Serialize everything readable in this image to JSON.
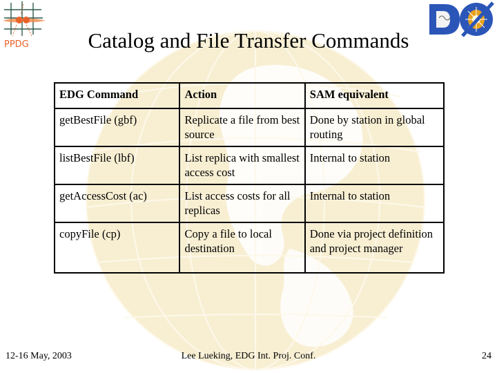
{
  "slide": {
    "title": "Catalog and File Transfer Commands",
    "logos": {
      "left": "PPDG",
      "right": "DØ"
    }
  },
  "table": {
    "headers": [
      "EDG Command",
      "Action",
      "SAM equivalent"
    ],
    "rows": [
      [
        "getBestFile (gbf)",
        "Replicate a file from best source",
        "Done by station in global routing"
      ],
      [
        "listBestFile (lbf)",
        "List replica with smallest access cost",
        "Internal to station"
      ],
      [
        "getAccessCost (ac)",
        "List access costs for all replicas",
        "Internal to station"
      ],
      [
        "copyFile (cp)",
        "Copy a file to local destination",
        "Done via project definition and project manager"
      ]
    ]
  },
  "footer": {
    "date": "12-16 May, 2003",
    "center": "Lee Lueking, EDG Int. Proj. Conf.",
    "page": "24"
  },
  "colors": {
    "globe": "#f7eccb",
    "globe_lines": "#fdf8ea",
    "ppdg_orange": "#e8632a",
    "ppdg_grid": "#2f5a4a",
    "d0_blue": "#2b56b8"
  }
}
